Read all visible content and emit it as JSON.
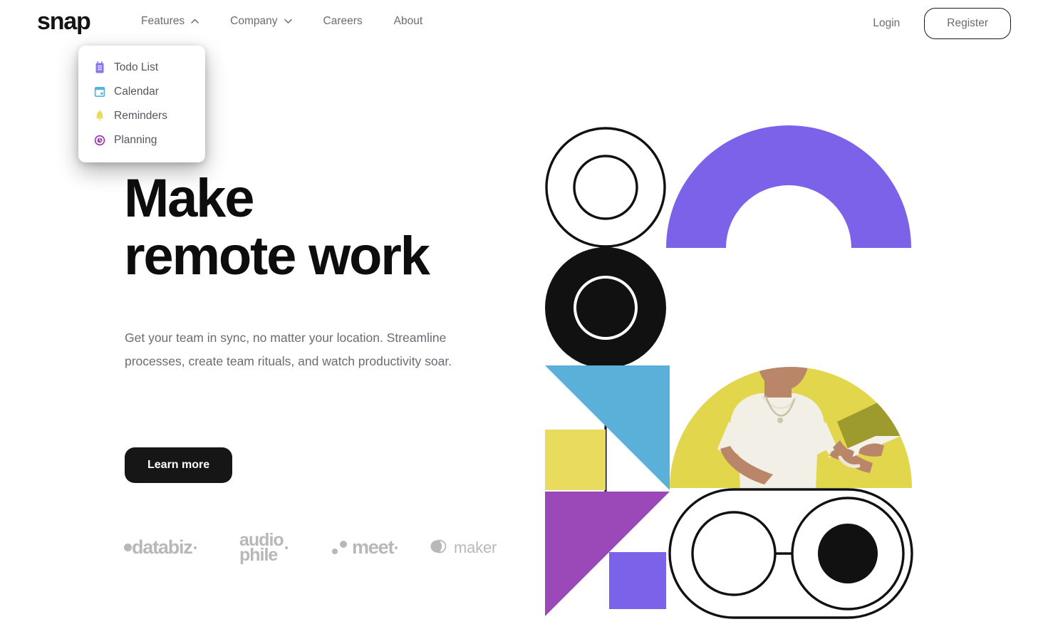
{
  "brand": {
    "name": "snap"
  },
  "nav": {
    "items": [
      {
        "label": "Features",
        "icon": "chevron-up-icon",
        "expanded": true
      },
      {
        "label": "Company",
        "icon": "chevron-down-icon",
        "expanded": false
      },
      {
        "label": "Careers",
        "icon": null,
        "expanded": false
      },
      {
        "label": "About",
        "icon": null,
        "expanded": false
      }
    ]
  },
  "auth": {
    "login_label": "Login",
    "register_label": "Register"
  },
  "dropdown": {
    "owner": "Features",
    "items": [
      {
        "label": "Todo List",
        "icon": "todo-list-icon",
        "color": "#8B74F0"
      },
      {
        "label": "Calendar",
        "icon": "calendar-icon",
        "color": "#56B2DE"
      },
      {
        "label": "Reminders",
        "icon": "reminder-bell-icon",
        "color": "#E8DB5E"
      },
      {
        "label": "Planning",
        "icon": "planning-clock-icon",
        "color": "#9B3BB0"
      }
    ]
  },
  "hero": {
    "title_line1": "Make",
    "title_line2": "remote work",
    "body": "Get your team in sync, no matter your location. Streamline processes, create team rituals, and watch productivity soar.",
    "cta_label": "Learn more"
  },
  "clients": [
    {
      "name": "databiz",
      "logo": "databiz-logo"
    },
    {
      "name": "audiophile",
      "line1": "audio",
      "line2": "phile",
      "logo": "audiophile-logo"
    },
    {
      "name": "meet",
      "logo": "meet-logo"
    },
    {
      "name": "maker",
      "logo": "maker-logo"
    }
  ],
  "graphic": {
    "alt": "abstract geometric hero collage with photo of a man using a laptop",
    "colors": {
      "purple": "#7C62E8",
      "yellow": "#E8DB5E",
      "cyan": "#5BB0DA",
      "magenta": "#9B48B8",
      "black": "#111111",
      "photo_bg": "#E2D64D",
      "skin": "#B9866A",
      "shirt": "#F2EFE7",
      "laptop": "#9E9B2E",
      "hair": "#A5774A"
    }
  }
}
